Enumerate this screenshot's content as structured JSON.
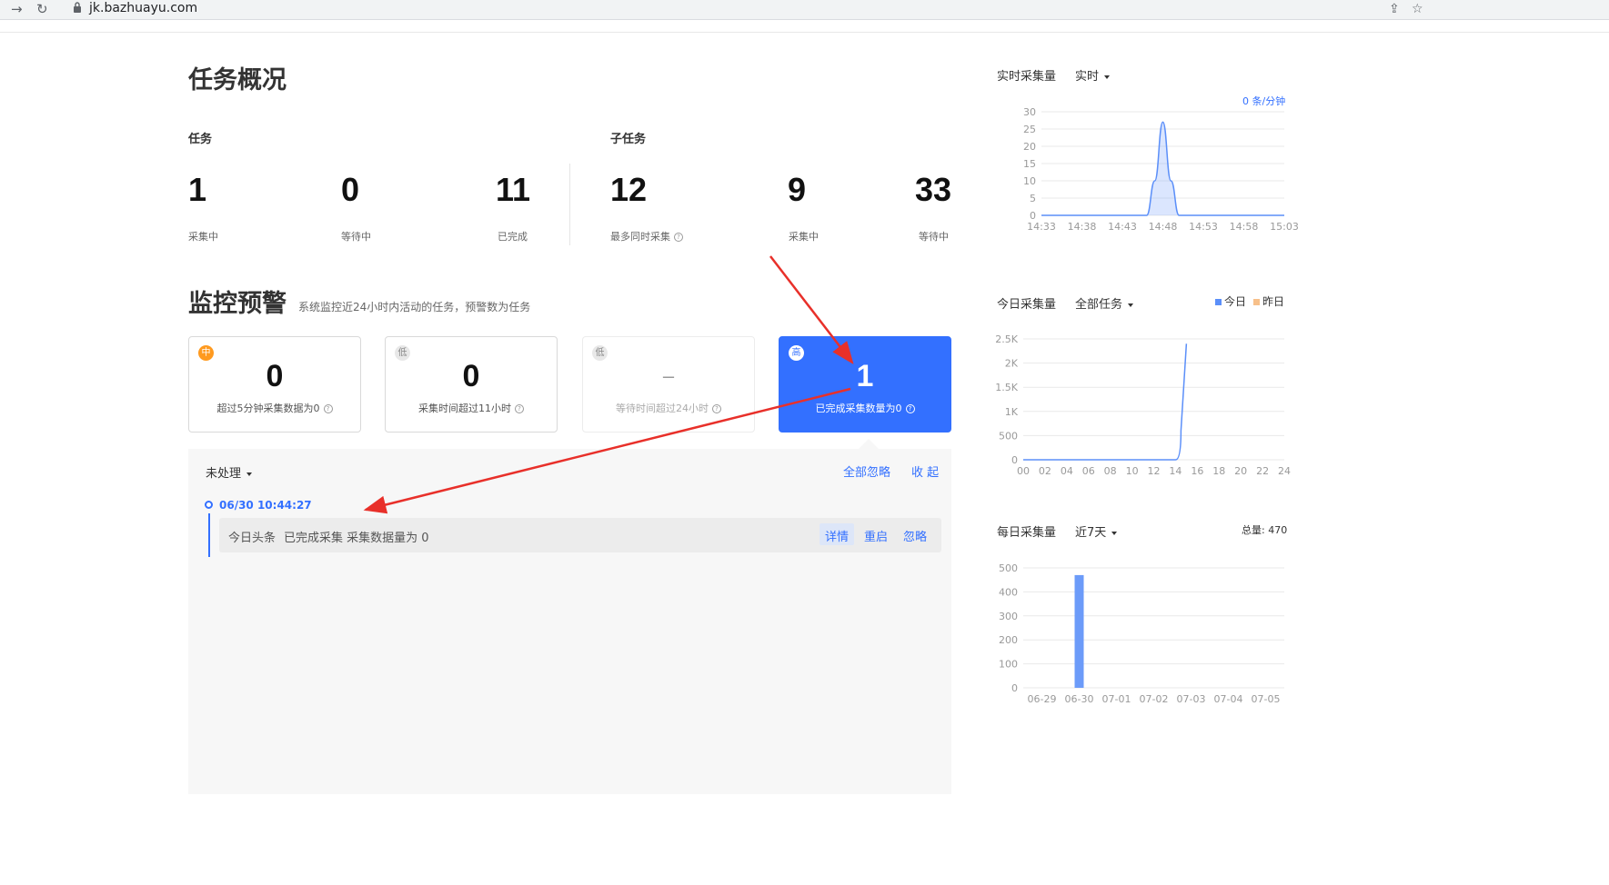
{
  "browser": {
    "url": "jk.bazhuayu.com",
    "back_icon": "→",
    "reload_icon": "↻",
    "share_icon": "⇪",
    "star_icon": "☆"
  },
  "overview": {
    "title": "任务概况",
    "task_heading": "任务",
    "subtask_heading": "子任务",
    "tasks": [
      {
        "value": "1",
        "label": "采集中"
      },
      {
        "value": "0",
        "label": "等待中"
      },
      {
        "value": "11",
        "label": "已完成"
      }
    ],
    "subtasks": [
      {
        "value": "12",
        "label": "最多同时采集"
      },
      {
        "value": "9",
        "label": "采集中"
      },
      {
        "value": "33",
        "label": "等待中"
      }
    ]
  },
  "monitor": {
    "title": "监控预警",
    "description": "系统监控近24小时内活动的任务，预警数为任务",
    "cards": [
      {
        "level": "中",
        "value": "0",
        "label": "超过5分钟采集数据为0"
      },
      {
        "level": "低",
        "value": "0",
        "label": "采集时间超过11小时"
      },
      {
        "level": "低",
        "value": "–",
        "label": "等待时间超过24小时"
      },
      {
        "level": "高",
        "value": "1",
        "label": "已完成采集数量为0"
      }
    ],
    "help_icon": "?",
    "status_filter": "未处理",
    "ignore_all": "全部忽略",
    "collapse": "收 起",
    "event": {
      "time": "06/30 10:44:27",
      "task_name": "今日头条",
      "message": "已完成采集  采集数据量为 0",
      "actions": [
        "详情",
        "重启",
        "忽略"
      ]
    }
  },
  "realtime": {
    "title": "实时采集量",
    "mode": "实时",
    "rate": "0 条/分钟"
  },
  "today": {
    "title": "今日采集量",
    "filter": "全部任务",
    "legend": [
      "今日",
      "昨日"
    ]
  },
  "daily": {
    "title": "每日采集量",
    "range": "近7天",
    "total": "总量: 470"
  },
  "colors": {
    "accent": "#3370ff",
    "warning": "#ff9a1f",
    "yesterday": "#f7c08a",
    "arrow": "#e8302a"
  },
  "chart_data": [
    {
      "type": "area",
      "title": "实时采集量",
      "x": [
        "14:33",
        "14:38",
        "14:43",
        "14:48",
        "14:53",
        "14:58",
        "15:03"
      ],
      "y_ticks": [
        "30",
        "25",
        "20",
        "15",
        "10",
        "5",
        "0"
      ],
      "ylim": [
        0,
        30
      ],
      "series": [
        {
          "name": "",
          "points": [
            [
              "14:33",
              0
            ],
            [
              "14:46",
              0
            ],
            [
              "14:47",
              10
            ],
            [
              "14:48",
              27
            ],
            [
              "14:49",
              10
            ],
            [
              "14:50",
              0
            ],
            [
              "15:03",
              0
            ]
          ]
        }
      ],
      "grid": true
    },
    {
      "type": "line",
      "title": "今日采集量",
      "x": [
        "00",
        "02",
        "04",
        "06",
        "08",
        "10",
        "12",
        "14",
        "16",
        "18",
        "20",
        "22",
        "24"
      ],
      "y_ticks": [
        "2.5K",
        "2K",
        "1.5K",
        "1K",
        "500",
        "0"
      ],
      "ylim": [
        0,
        2500
      ],
      "series": [
        {
          "name": "今日",
          "points": [
            [
              0,
              0
            ],
            [
              14,
              0
            ],
            [
              14.5,
              600
            ],
            [
              15,
              2400
            ]
          ]
        }
      ],
      "grid": true
    },
    {
      "type": "bar",
      "title": "每日采集量",
      "categories": [
        "06-29",
        "06-30",
        "07-01",
        "07-02",
        "07-03",
        "07-04",
        "07-05"
      ],
      "values": [
        0,
        470,
        0,
        0,
        0,
        0,
        0
      ],
      "y_ticks": [
        "500",
        "400",
        "300",
        "200",
        "100",
        "0"
      ],
      "ylim": [
        0,
        500
      ],
      "grid": true
    }
  ]
}
